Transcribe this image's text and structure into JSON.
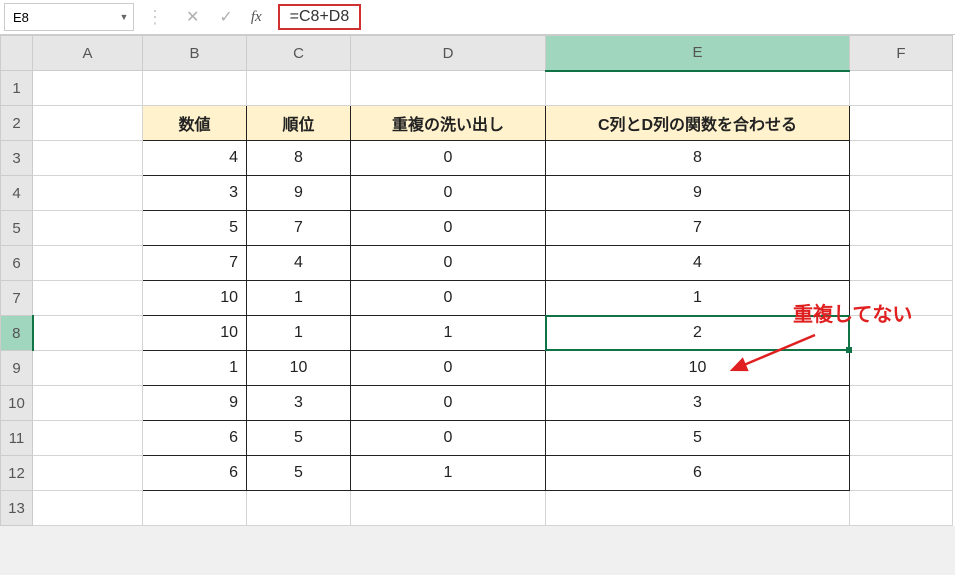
{
  "formula_bar": {
    "name_box": "E8",
    "formula": "=C8+D8"
  },
  "columns": [
    "A",
    "B",
    "C",
    "D",
    "E",
    "F"
  ],
  "rows": [
    1,
    2,
    3,
    4,
    5,
    6,
    7,
    8,
    9,
    10,
    11,
    12,
    13
  ],
  "selected": {
    "cell": "E8",
    "col": "E",
    "row": 8
  },
  "headers": {
    "B": "数値",
    "C": "順位",
    "D": "重複の洗い出し",
    "E": "C列とD列の関数を合わせる"
  },
  "data_rows": [
    {
      "B": 4,
      "C": 8,
      "D": 0,
      "E": 8
    },
    {
      "B": 3,
      "C": 9,
      "D": 0,
      "E": 9
    },
    {
      "B": 5,
      "C": 7,
      "D": 0,
      "E": 7
    },
    {
      "B": 7,
      "C": 4,
      "D": 0,
      "E": 4
    },
    {
      "B": 10,
      "C": 1,
      "D": 0,
      "E": 1
    },
    {
      "B": 10,
      "C": 1,
      "D": 1,
      "E": 2
    },
    {
      "B": 1,
      "C": 10,
      "D": 0,
      "E": 10
    },
    {
      "B": 9,
      "C": 3,
      "D": 0,
      "E": 3
    },
    {
      "B": 6,
      "C": 5,
      "D": 0,
      "E": 5
    },
    {
      "B": 6,
      "C": 5,
      "D": 1,
      "E": 6
    }
  ],
  "annotation": "重複してない",
  "chart_data": {
    "type": "table",
    "title": "",
    "columns": [
      "数値",
      "順位",
      "重複の洗い出し",
      "C列とD列の関数を合わせる"
    ],
    "rows": [
      [
        4,
        8,
        0,
        8
      ],
      [
        3,
        9,
        0,
        9
      ],
      [
        5,
        7,
        0,
        7
      ],
      [
        7,
        4,
        0,
        4
      ],
      [
        10,
        1,
        0,
        1
      ],
      [
        10,
        1,
        1,
        2
      ],
      [
        1,
        10,
        0,
        10
      ],
      [
        9,
        3,
        0,
        3
      ],
      [
        6,
        5,
        0,
        5
      ],
      [
        6,
        5,
        1,
        6
      ]
    ]
  }
}
